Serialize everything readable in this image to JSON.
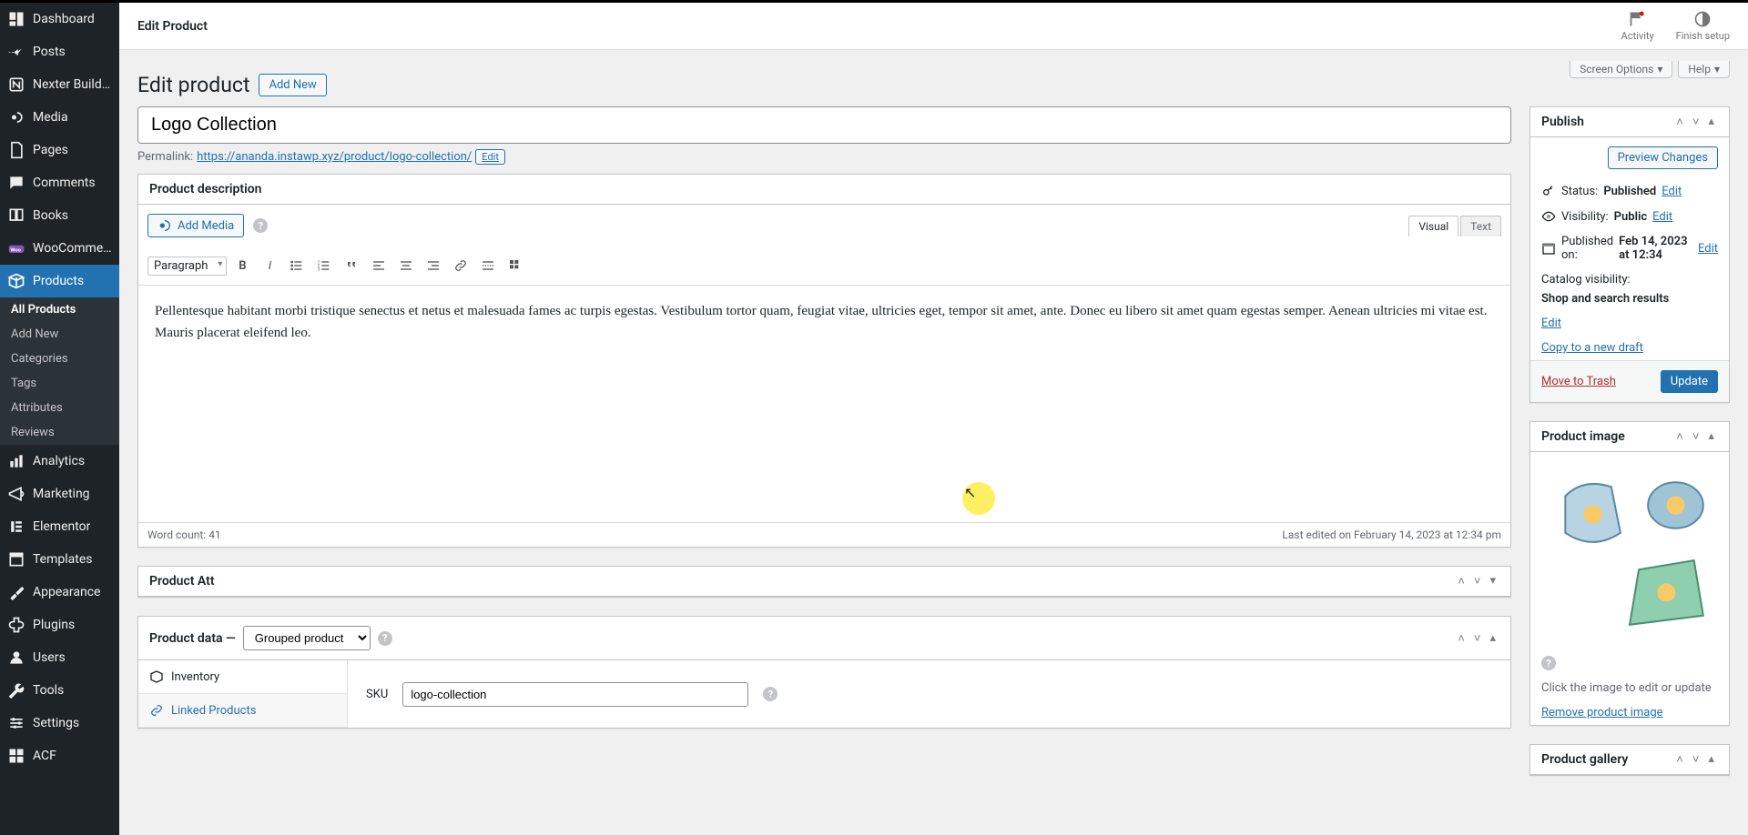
{
  "sidebar": {
    "groups": [
      {
        "icon": "dashboard",
        "label": "Dashboard"
      },
      {
        "icon": "pin",
        "label": "Posts"
      },
      {
        "icon": "nexter",
        "label": "Nexter Builder"
      },
      {
        "icon": "media",
        "label": "Media"
      },
      {
        "icon": "page",
        "label": "Pages"
      },
      {
        "icon": "comment",
        "label": "Comments"
      },
      {
        "icon": "book",
        "label": "Books"
      },
      {
        "icon": "woo",
        "label": "WooCommerce"
      },
      {
        "icon": "product",
        "label": "Products",
        "active": true
      },
      {
        "icon": "analytics",
        "label": "Analytics"
      },
      {
        "icon": "marketing",
        "label": "Marketing"
      },
      {
        "icon": "elementor",
        "label": "Elementor"
      },
      {
        "icon": "templates",
        "label": "Templates"
      },
      {
        "icon": "appearance",
        "label": "Appearance"
      },
      {
        "icon": "plugin",
        "label": "Plugins"
      },
      {
        "icon": "users",
        "label": "Users"
      },
      {
        "icon": "tools",
        "label": "Tools"
      },
      {
        "icon": "settings",
        "label": "Settings"
      },
      {
        "icon": "acf",
        "label": "ACF"
      }
    ],
    "submenu": [
      {
        "label": "All Products",
        "active": true
      },
      {
        "label": "Add New"
      },
      {
        "label": "Categories"
      },
      {
        "label": "Tags"
      },
      {
        "label": "Attributes"
      },
      {
        "label": "Reviews"
      }
    ]
  },
  "topbar": {
    "title": "Edit Product",
    "activity": "Activity",
    "finish": "Finish setup"
  },
  "header": {
    "page_title": "Edit product",
    "add_new": "Add New",
    "screen_options": "Screen Options",
    "help": "Help"
  },
  "product": {
    "title": "Logo Collection",
    "permalink_label": "Permalink:",
    "permalink": "https://ananda.instawp.xyz/product/logo-collection/",
    "edit": "Edit"
  },
  "description": {
    "heading": "Product description",
    "add_media": "Add Media",
    "visual": "Visual",
    "text": "Text",
    "paragraph": "Paragraph",
    "content": "Pellentesque habitant morbi tristique senectus et netus et malesuada fames ac turpis egestas. Vestibulum tortor quam, feugiat vitae, ultricies eget, tempor sit amet, ante. Donec eu libero sit amet quam egestas semper. Aenean ultricies mi vitae est. Mauris placerat eleifend leo.",
    "word_count_label": "Word count: ",
    "word_count": "41",
    "last_edited": "Last edited on February 14, 2023 at 12:34 pm"
  },
  "product_att": {
    "heading": "Product Att"
  },
  "product_data": {
    "heading": "Product data —",
    "type": "Grouped product",
    "tabs": {
      "inventory": "Inventory",
      "linked": "Linked Products"
    },
    "sku_label": "SKU",
    "sku": "logo-collection"
  },
  "publish": {
    "heading": "Publish",
    "preview": "Preview Changes",
    "status_label": "Status:",
    "status": "Published",
    "visibility_label": "Visibility:",
    "visibility": "Public",
    "published_label": "Published on:",
    "published": "Feb 14, 2023 at 12:34",
    "catalog_label": "Catalog visibility:",
    "catalog": "Shop and search results",
    "copy": "Copy to a new draft",
    "trash": "Move to Trash",
    "update": "Update",
    "edit": "Edit"
  },
  "product_image": {
    "heading": "Product image",
    "hint": "Click the image to edit or update",
    "remove": "Remove product image"
  },
  "product_gallery": {
    "heading": "Product gallery"
  }
}
